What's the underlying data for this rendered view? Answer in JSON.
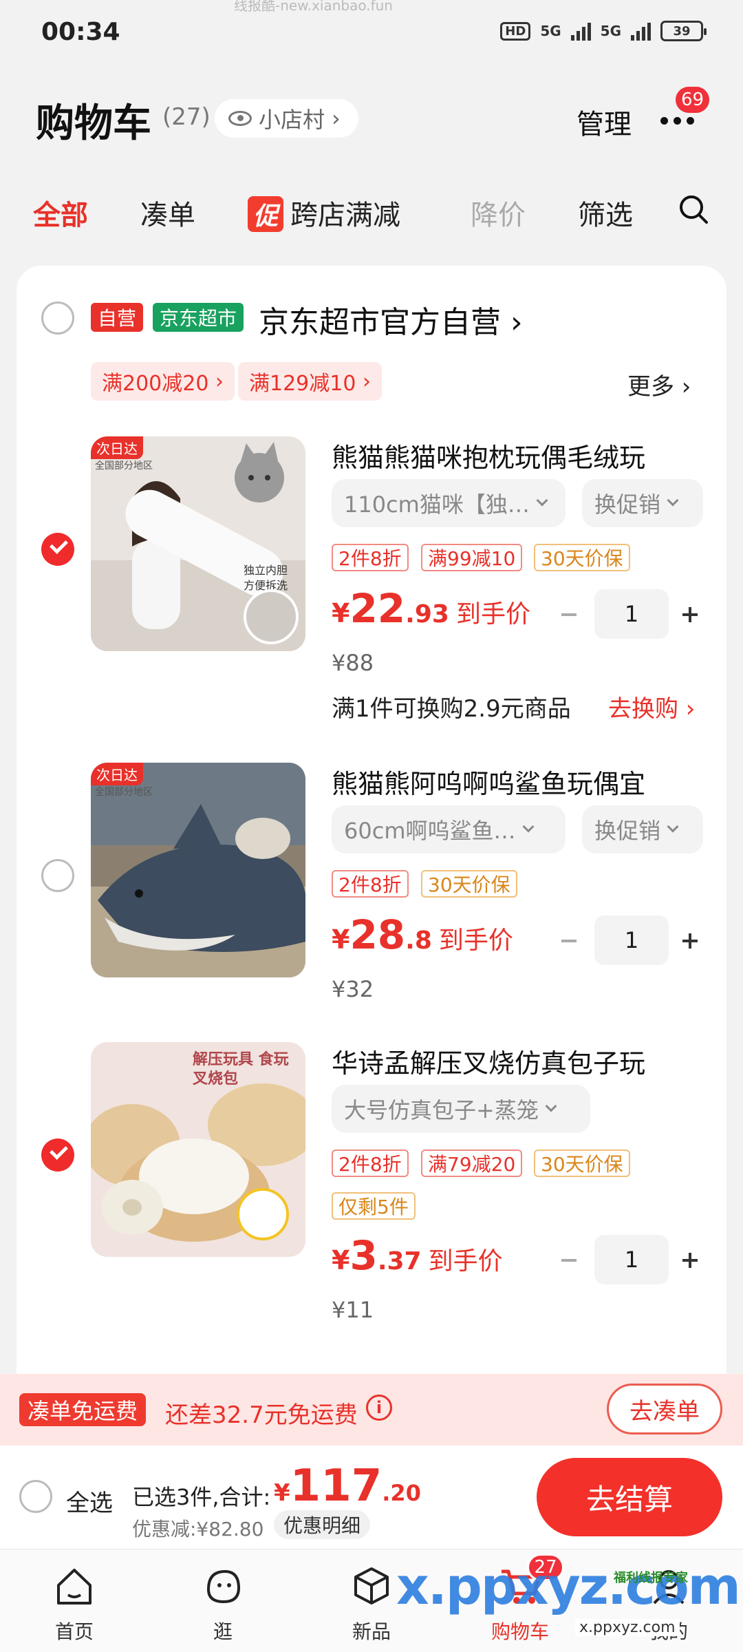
{
  "status": {
    "time": "00:34",
    "hd": "HD",
    "net1": "5G",
    "net2": "5G",
    "battery": "39"
  },
  "top_watermark": "线报酷-new.xianbao.fun",
  "header": {
    "title": "购物车",
    "count": "(27)",
    "shop_village": "小店村",
    "manage": "管理",
    "more_badge": "69"
  },
  "tabs": {
    "all": "全部",
    "combine": "凑单",
    "promo_icon": "促",
    "cross_store": "跨店满减",
    "price_drop": "降价",
    "filter": "筛选"
  },
  "store": {
    "tag_self": "自营",
    "tag_jd": "京东超市",
    "name": "京东超市官方自营",
    "coupons": [
      "满200减20",
      "满129减10"
    ],
    "more": "更多"
  },
  "products": [
    {
      "thumb_label": "次日达",
      "thumb_sub": "全国部分地区",
      "title": "熊猫熊猫咪抱枕玩偶毛绒玩",
      "spec": "110cm猫咪【独…",
      "promo_spec": "换促销",
      "tags": [
        "2件8折",
        "满99减10",
        "30天价保"
      ],
      "price_cur": "¥",
      "price_int": "22",
      "price_dec": ".93",
      "price_suffix": "到手价",
      "orig_price": "¥88",
      "qty": "1",
      "exchange_text": "满1件可换购2.9元商品",
      "exchange_link": "去换购",
      "checked": true
    },
    {
      "thumb_label": "次日达",
      "thumb_sub": "全国部分地区",
      "title": "熊猫熊阿呜啊呜鲨鱼玩偶宜",
      "spec": "60cm啊呜鲨鱼…",
      "promo_spec": "换促销",
      "tags": [
        "2件8折",
        "30天价保"
      ],
      "price_cur": "¥",
      "price_int": "28",
      "price_dec": ".8",
      "price_suffix": "到手价",
      "orig_price": "¥32",
      "qty": "1",
      "checked": false
    },
    {
      "thumb_text": "解压玩具 食玩叉烧包",
      "title": "华诗孟解压叉烧仿真包子玩",
      "spec": "大号仿真包子+蒸笼",
      "tags": [
        "2件8折",
        "满79减20",
        "30天价保",
        "仅剩5件"
      ],
      "price_cur": "¥",
      "price_int": "3",
      "price_dec": ".37",
      "price_suffix": "到手价",
      "orig_price": "¥11",
      "qty": "1",
      "checked": true
    }
  ],
  "shipping": {
    "tag": "凑单免运费",
    "text": "还差32.7元免运费",
    "info": "i",
    "button": "去凑单"
  },
  "checkout": {
    "select_all": "全选",
    "summary": "已选3件,合计:",
    "total_cur": "¥",
    "total_int": "117",
    "total_dec": ".20",
    "discount": "优惠减:¥82.80",
    "detail": "优惠明细",
    "pay": "去结算"
  },
  "nav": {
    "home": "首页",
    "browse": "逛",
    "new": "新品",
    "cart": "购物车",
    "cart_badge": "27",
    "mine": "我的"
  },
  "watermark": {
    "main": "x.ppxyz.com",
    "small": "福利线报专家",
    "url": "x.ppxyz.com"
  },
  "colors": {
    "accent": "#e8312a",
    "jd_green": "#19a15f",
    "ship_bg": "#fde6e4"
  }
}
